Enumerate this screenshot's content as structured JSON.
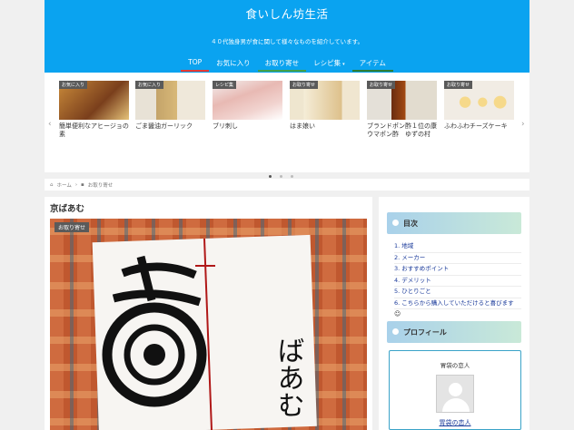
{
  "site": {
    "title": "食いしん坊生活",
    "tagline": "４０代独身男が食に関して様々なものを紹介しています。"
  },
  "nav": [
    {
      "label": "TOP",
      "color": "#e53935"
    },
    {
      "label": "お気に入り",
      "color": "#0aa3f0"
    },
    {
      "label": "お取り寄せ",
      "color": "#43a047"
    },
    {
      "label": "レシピ集",
      "color": "#0aa3f0",
      "dropdown": true
    },
    {
      "label": "アイテム",
      "color": "#2e7d32"
    }
  ],
  "carousel": {
    "items": [
      {
        "badge": "お気に入り",
        "title": "簡単便利なアヒージョの素"
      },
      {
        "badge": "お気に入り",
        "title": "ごま醤油ガーリック"
      },
      {
        "badge": "レシピ集",
        "title": "ブリ刺し"
      },
      {
        "badge": "お取り寄せ",
        "title": "はま娘い"
      },
      {
        "badge": "お取り寄せ",
        "title": "ブランドポン酢１位の康ウマポン酢　ゆずの村"
      },
      {
        "badge": "お取り寄せ",
        "title": "ふわふわチーズケーキ"
      }
    ],
    "prev_arrow": "‹",
    "next_arrow": "›"
  },
  "breadcrumb": {
    "home": "ホーム",
    "category": "お取り寄せ"
  },
  "post": {
    "title": "京ばあむ",
    "badge": "お取り寄せ",
    "image_text": "ばあむ"
  },
  "sidebar": {
    "toc_title": "目次",
    "toc_items": [
      "1. 地域",
      "2. メーカー",
      "3. おすすめポイント",
      "4. デメリット",
      "5. ひとりごと",
      "6. こちらから購入していただけると喜びます"
    ],
    "profile_title": "プロフィール",
    "profile_name": "胃袋の恋人",
    "profile_link": "胃袋の恋人"
  }
}
